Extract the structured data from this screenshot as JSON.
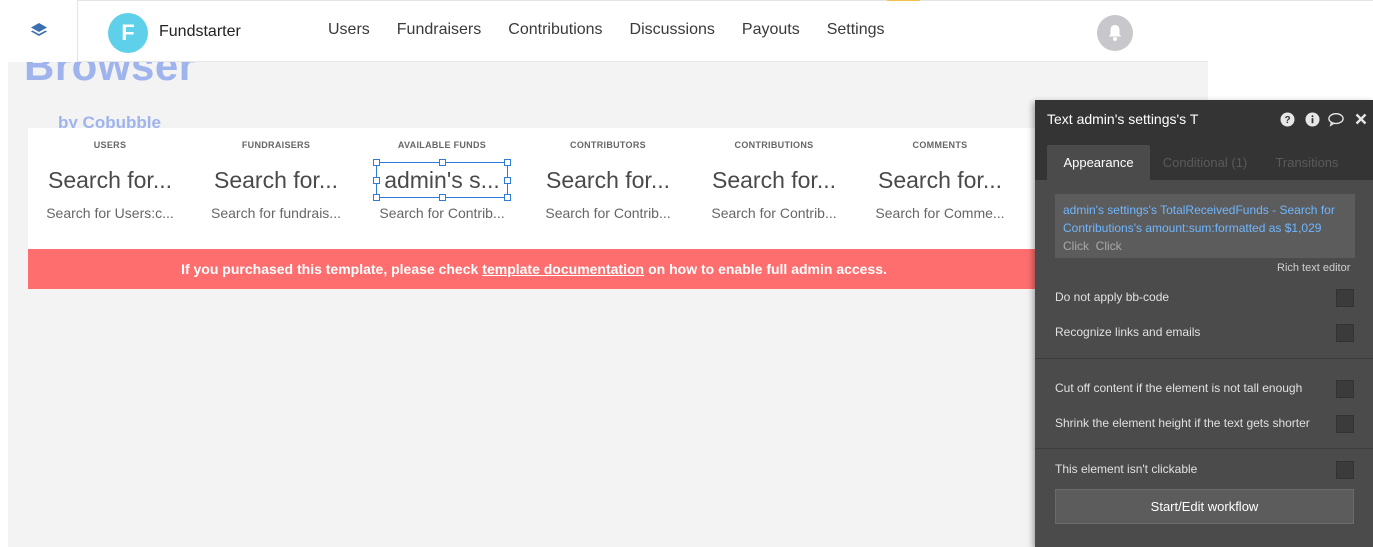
{
  "header": {
    "logo_letter": "F",
    "brand": "Fundstarter",
    "nav": [
      "Users",
      "Fundraisers",
      "Contributions",
      "Discussions",
      "Payouts",
      "Settings"
    ]
  },
  "canvas": {
    "hero_title": "Browser",
    "hero_byline": "by Cobubble"
  },
  "stats": [
    {
      "label": "USERS",
      "value": "Search for...",
      "sub": "Search for Users:c..."
    },
    {
      "label": "FUNDRAISERS",
      "value": "Search for...",
      "sub": "Search for fundrais..."
    },
    {
      "label": "AVAILABLE FUNDS",
      "value": "admin's s...",
      "sub": "Search for Contrib..."
    },
    {
      "label": "CONTRIBUTORS",
      "value": "Search for...",
      "sub": "Search for Contrib..."
    },
    {
      "label": "CONTRIBUTIONS",
      "value": "Search for...",
      "sub": "Search for Contrib..."
    },
    {
      "label": "COMMENTS",
      "value": "Search for...",
      "sub": "Search for Comme..."
    }
  ],
  "banner": {
    "before": "If you purchased this template, please check",
    "link": "template documentation",
    "after": "on how to enable full admin access."
  },
  "panel": {
    "title": "Text admin's settings's T",
    "icons": [
      "help-icon",
      "info-icon",
      "comment-icon",
      "close-icon"
    ],
    "tabs": [
      "Appearance",
      "Conditional (1)",
      "Transitions"
    ],
    "expression": "admin's settings's TotalReceivedFunds - Search for Contributions's amount:sum:formatted as $1,029",
    "click1": "Click",
    "click2": "Click",
    "rich_editor": "Rich text editor",
    "options": [
      "Do not apply bb-code",
      "Recognize links and emails",
      "Cut off content if the element is not tall enough",
      "Shrink the element height if the text gets shorter",
      "This element isn't clickable"
    ],
    "workflow_button": "Start/Edit workflow"
  },
  "colors": {
    "accent_blue": "#2f7bd6",
    "banner": "#ff6e6e",
    "logo": "#5ed0ea",
    "expression_text": "#6fb6ff"
  }
}
